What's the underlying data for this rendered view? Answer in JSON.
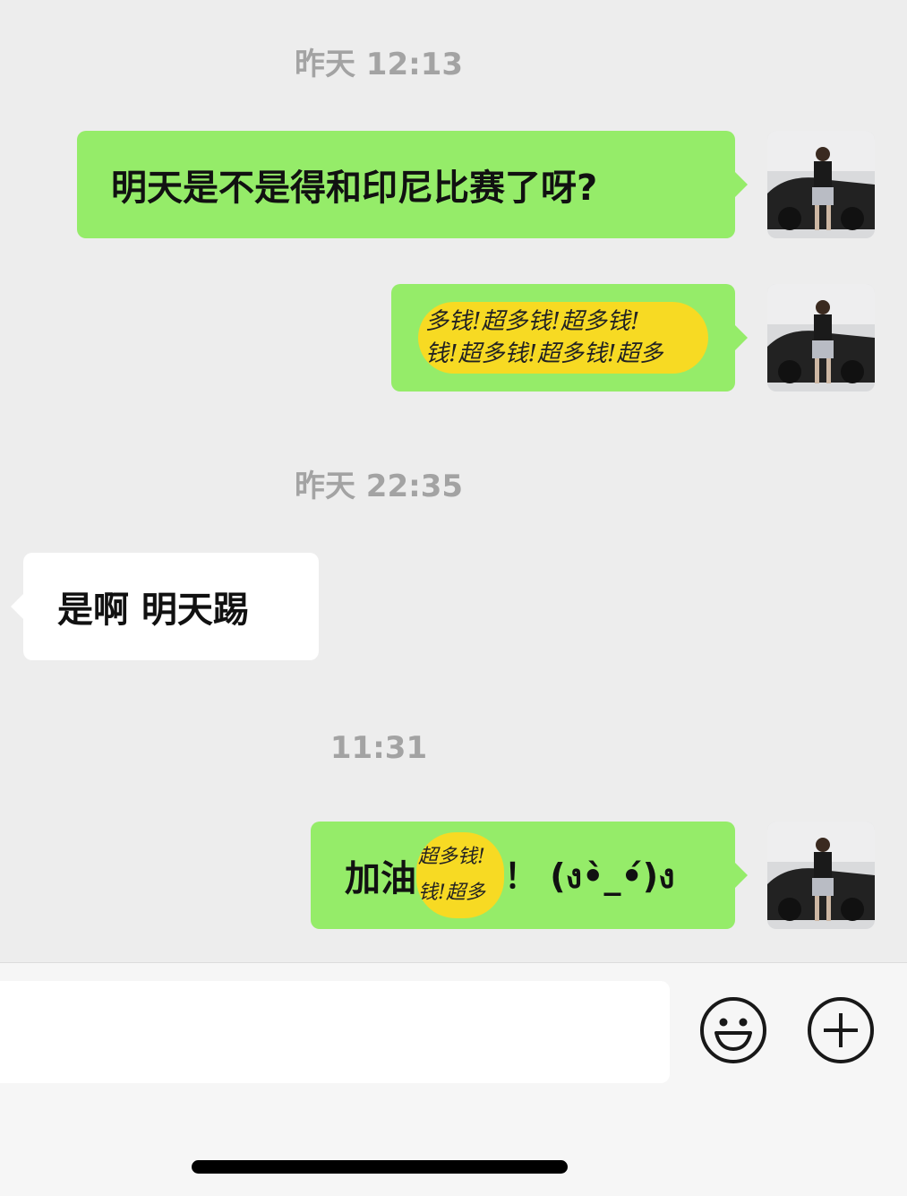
{
  "messages": [
    {
      "type": "time",
      "text": "昨天 12:13"
    },
    {
      "type": "text",
      "from": "me",
      "text": "明天是不是得和印尼比赛了呀?"
    },
    {
      "type": "sticker",
      "from": "me",
      "sticker_text_line1": "多钱!超多钱!超多钱!",
      "sticker_text_line2": "钱!超多钱!超多钱!超多"
    },
    {
      "type": "time",
      "text": "昨天 22:35"
    },
    {
      "type": "text",
      "from": "other",
      "text": "是啊 明天踢"
    },
    {
      "type": "time",
      "text": "11:31"
    },
    {
      "type": "text_with_sticker",
      "from": "me",
      "prefix": "加油",
      "sticker_line1": "超多钱!",
      "sticker_line2": "钱!超多",
      "suffix": "！ (ง•̀_•́)ง"
    }
  ],
  "input_bar": {
    "emoji_icon": "smiley-face-icon",
    "more_icon": "plus-circle-icon"
  },
  "colors": {
    "background": "#ededed",
    "my_bubble": "#95ec69",
    "other_bubble": "#ffffff",
    "time_text": "#a3a3a3",
    "sticker": "#f7da23"
  }
}
